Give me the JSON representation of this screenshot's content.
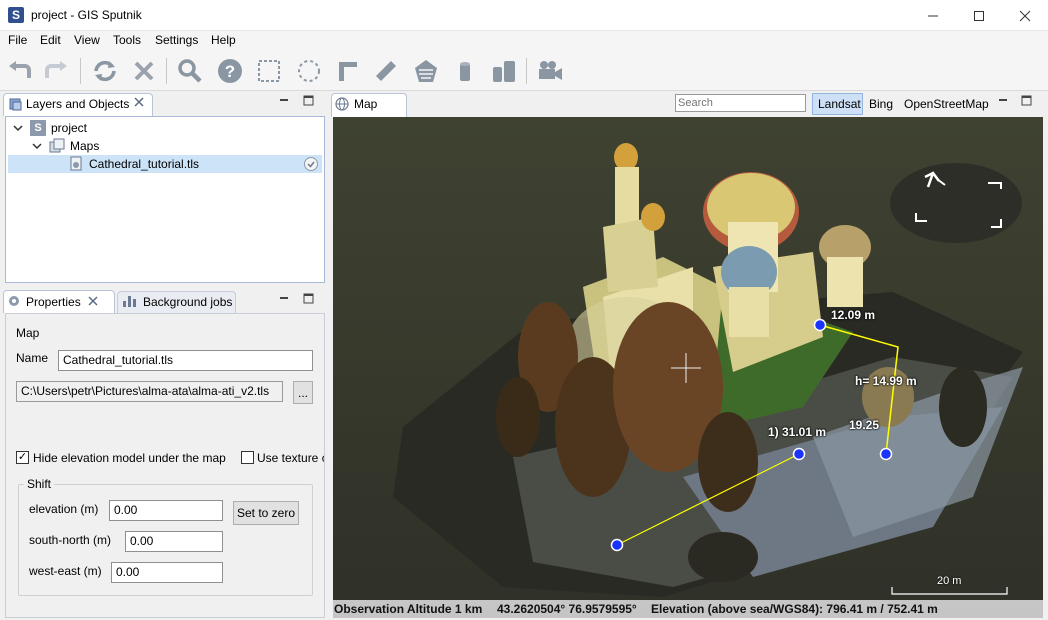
{
  "window": {
    "title": "project - GIS Sputnik",
    "icon_letter": "S",
    "controls": [
      "minimize",
      "maximize",
      "close"
    ]
  },
  "menu": [
    "File",
    "Edit",
    "View",
    "Tools",
    "Settings",
    "Help"
  ],
  "toolbar": {
    "buttons": [
      "undo",
      "redo",
      "refresh",
      "clear",
      "zoom",
      "help",
      "select-rectangle",
      "select-polygon",
      "measure-angle",
      "measure-ruler",
      "measure-area",
      "cylinder",
      "building-height",
      "video-camera"
    ]
  },
  "layers_panel": {
    "title": "Layers and Objects",
    "tree": {
      "root": "project",
      "folder": "Maps",
      "item": "Cathedral_tutorial.tls"
    }
  },
  "properties_panel": {
    "tab_properties": "Properties",
    "tab_jobs": "Background jobs",
    "section": "Map",
    "name_label": "Name",
    "name_value": "Cathedral_tutorial.tls",
    "path_value": "C:\\Users\\petr\\Pictures\\alma-ata\\alma-ati_v2.tls",
    "browse_label": "...",
    "hide_elevation_label": "Hide elevation model under the map",
    "hide_elevation_checked": true,
    "use_texture_label": "Use texture c",
    "use_texture_checked": false,
    "shift_group": "Shift",
    "elevation_label": "elevation (m)",
    "elevation_value": "0.00",
    "set_zero_label": "Set to zero",
    "south_north_label": "south-north (m)",
    "south_north_value": "0.00",
    "west_east_label": "west-east (m)",
    "west_east_value": "0.00"
  },
  "map_panel": {
    "tab": "Map",
    "search_placeholder": "Search",
    "sources": [
      "Landsat",
      "Bing",
      "OpenStreetMap"
    ],
    "active_source": "Landsat",
    "measurements": {
      "top_edge": "12.09 m",
      "height": "h= 14.99 m",
      "right_edge": "19.25",
      "path": "1) 31.01 m"
    },
    "scale_label": "20 m",
    "status": {
      "altitude": "Observation Altitude 1 km",
      "coords": "43.2620504° 76.9579595°",
      "elevation": "Elevation (above sea/WGS84): 796.41 m / 752.41 m"
    }
  }
}
